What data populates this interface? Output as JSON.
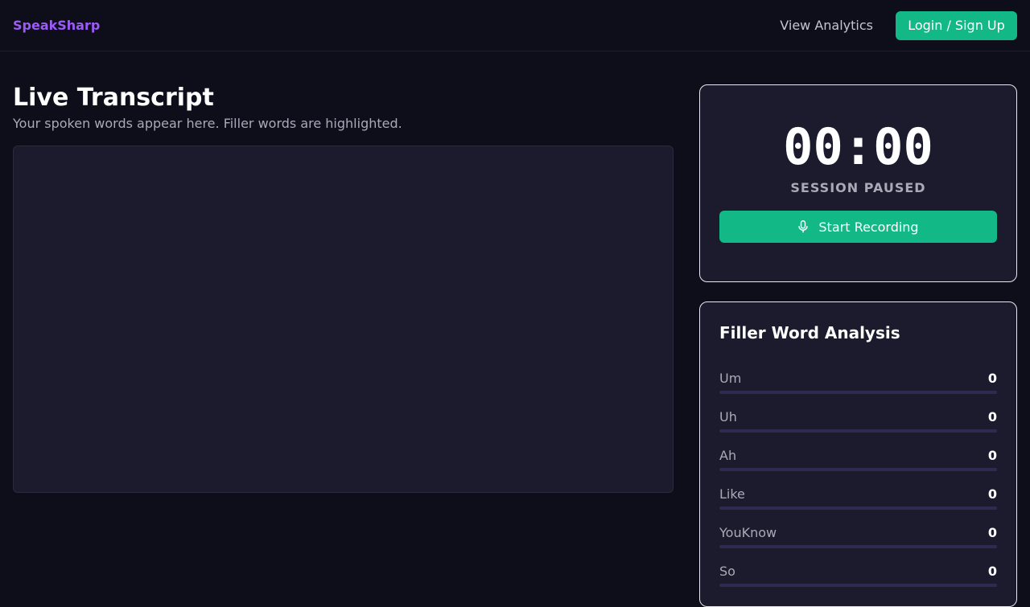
{
  "header": {
    "brand": "SpeakSharp",
    "analytics_link": "View Analytics",
    "login_button": "Login / Sign Up"
  },
  "main": {
    "title": "Live Transcript",
    "subtitle": "Your spoken words appear here. Filler words are highlighted.",
    "transcript_text": ""
  },
  "session": {
    "timer": "00:00",
    "status": "SESSION PAUSED",
    "record_button": "Start Recording",
    "record_icon": "microphone-icon"
  },
  "filler_analysis": {
    "title": "Filler Word Analysis",
    "items": [
      {
        "label": "Um",
        "count": "0",
        "fill_fraction": 0
      },
      {
        "label": "Uh",
        "count": "0",
        "fill_fraction": 0
      },
      {
        "label": "Ah",
        "count": "0",
        "fill_fraction": 0
      },
      {
        "label": "Like",
        "count": "0",
        "fill_fraction": 0
      },
      {
        "label": "YouKnow",
        "count": "0",
        "fill_fraction": 0
      },
      {
        "label": "So",
        "count": "0",
        "fill_fraction": 0
      }
    ]
  },
  "colors": {
    "accent": "#12b886",
    "brand": "#9b5cf6",
    "background": "#0e0d1a",
    "panel": "#1c1b2d"
  }
}
